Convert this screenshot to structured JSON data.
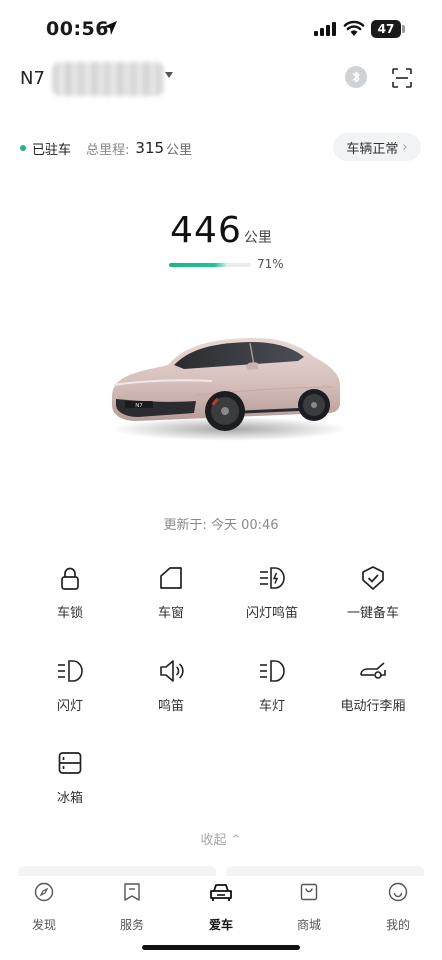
{
  "status_bar": {
    "time": "00:56",
    "battery": "47"
  },
  "header": {
    "model": "N7"
  },
  "vehicle": {
    "park_status": "已驻车",
    "odometer_label": "总里程:",
    "odometer_value": "315",
    "odometer_unit": "公里",
    "status_button": "车辆正常"
  },
  "range": {
    "value": "446",
    "unit": "公里",
    "percent_label": "71%",
    "percent": 0.71
  },
  "car_badge": "N7",
  "updated": "更新于: 今天 00:46",
  "controls": [
    {
      "label": "车锁",
      "icon": "lock-icon"
    },
    {
      "label": "车窗",
      "icon": "window-icon"
    },
    {
      "label": "闪灯鸣笛",
      "icon": "flash-horn-icon"
    },
    {
      "label": "一键备车",
      "icon": "shield-check-icon"
    },
    {
      "label": "闪灯",
      "icon": "headlight-icon"
    },
    {
      "label": "鸣笛",
      "icon": "horn-icon"
    },
    {
      "label": "车灯",
      "icon": "car-light-icon"
    },
    {
      "label": "电动行李厢",
      "icon": "trunk-icon"
    },
    {
      "label": "冰箱",
      "icon": "fridge-icon"
    }
  ],
  "collapse_label": "收起",
  "tabs": [
    {
      "label": "发现",
      "icon": "compass-icon"
    },
    {
      "label": "服务",
      "icon": "bookmark-icon"
    },
    {
      "label": "爱车",
      "icon": "car-icon",
      "active": true
    },
    {
      "label": "商城",
      "icon": "shopping-bag-icon"
    },
    {
      "label": "我的",
      "icon": "smiley-icon"
    }
  ],
  "colors": {
    "accent": "#21b18c",
    "car_body": "#d9c3bf",
    "text": "#1a1a1a"
  }
}
